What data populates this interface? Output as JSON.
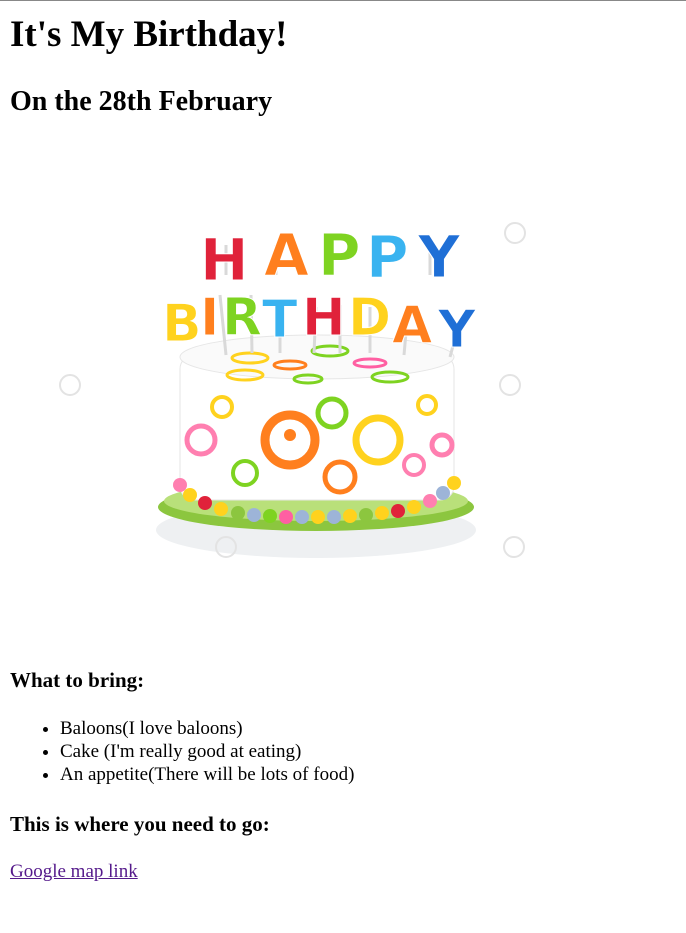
{
  "page": {
    "title": "It's My Birthday!",
    "date_heading": "On the 28th February"
  },
  "image": {
    "subject": "happy-birthday-cake",
    "candle_letters_row1": "HAPPY",
    "candle_letters_row2": "BIRTHDAY"
  },
  "bring": {
    "heading": "What to bring:",
    "items": [
      "Baloons(I love baloons)",
      "Cake (I'm really good at eating)",
      "An appetite(There will be lots of food)"
    ]
  },
  "location": {
    "heading": "This is where you need to go:",
    "link_text": "Google map link"
  },
  "colors": {
    "link_visited": "#551a8b",
    "letter_red": "#e0223a",
    "letter_orange": "#ff7f1e",
    "letter_green": "#7ed321",
    "letter_cyan": "#39b3f0",
    "letter_blue": "#1f6fd6",
    "letter_yellow": "#ffd21e"
  }
}
